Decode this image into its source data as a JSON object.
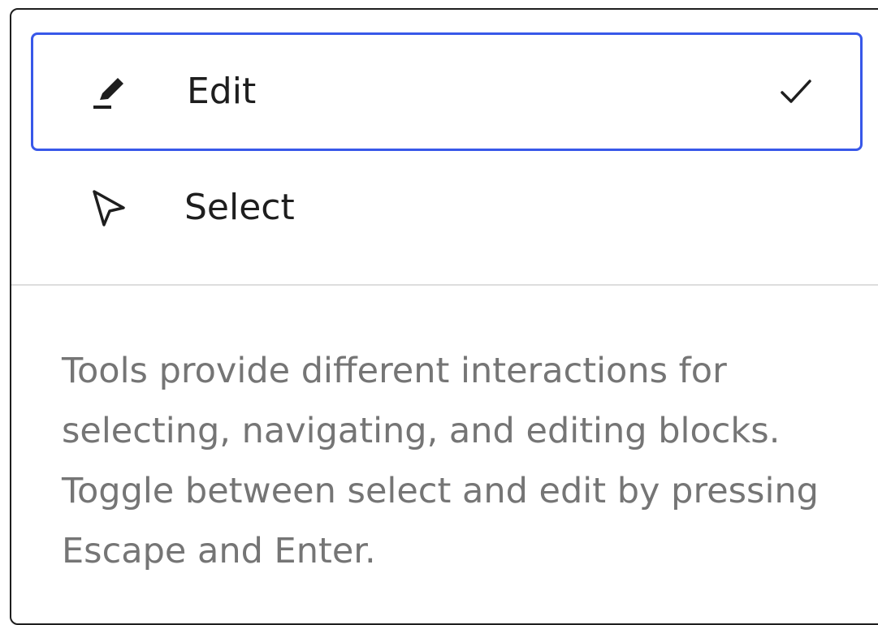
{
  "menu": {
    "items": [
      {
        "label": "Edit",
        "icon": "pencil-icon",
        "selected": true
      },
      {
        "label": "Select",
        "icon": "cursor-arrow-icon",
        "selected": false
      }
    ]
  },
  "help": {
    "text": "Tools provide different interactions for selecting, navigating, and editing blocks. Toggle between select and edit by pressing Escape and Enter."
  },
  "colors": {
    "focus_border": "#3858e9",
    "text": "#1e1e1e",
    "help_text": "#757575",
    "divider": "#dddddd"
  }
}
